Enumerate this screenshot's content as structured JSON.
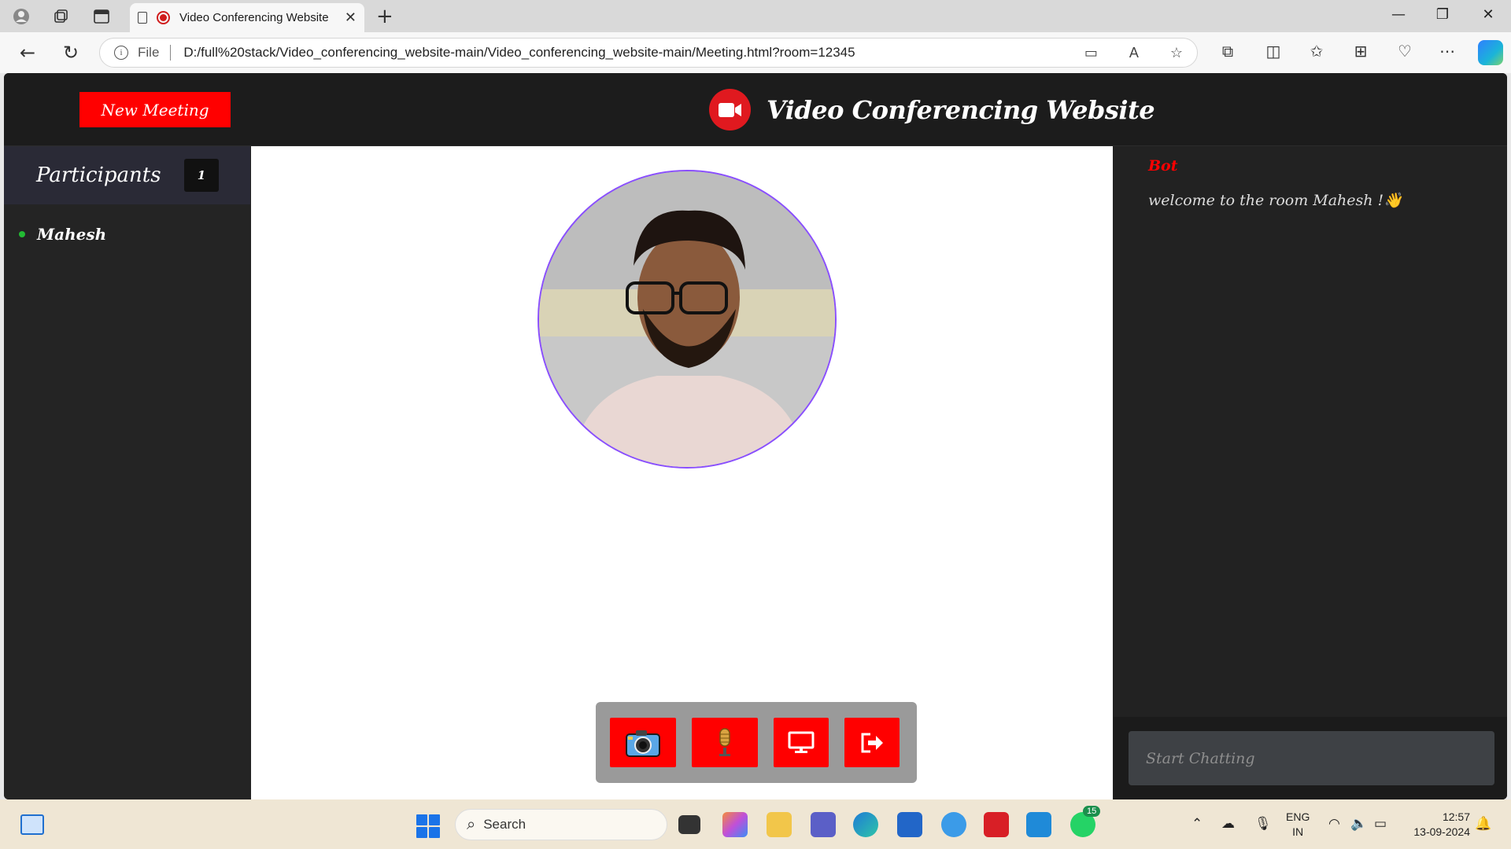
{
  "browser": {
    "tab_title": "Video Conferencing Website",
    "tab_close": "✕",
    "new_tab": "+",
    "file_label": "File",
    "url": "D:/full%20stack/Video_conferencing_website-main/Video_conferencing_website-main/Meeting.html?room=12345"
  },
  "header": {
    "new_meeting_label": "New Meeting",
    "brand_title": "Video Conferencing Website"
  },
  "participants": {
    "title": "Participants",
    "count": "1",
    "list": [
      {
        "name": "Mahesh",
        "status_color": "#22bb33"
      }
    ]
  },
  "controls": {
    "buttons": [
      "camera-icon",
      "microphone-icon",
      "screen-share-icon",
      "leave-icon"
    ]
  },
  "chat": {
    "messages": [
      {
        "sender": "Bot",
        "text": "welcome to the room Mahesh !👋"
      }
    ],
    "input_placeholder": "Start Chatting"
  },
  "taskbar": {
    "search_label": "Search",
    "lang_top": "ENG",
    "lang_bottom": "IN",
    "time": "12:57",
    "date": "13-09-2024",
    "whatsapp_badge": "15"
  },
  "colors": {
    "accent": "#ff0000",
    "app_bg": "#222222",
    "video_border": "#8a4fff"
  }
}
